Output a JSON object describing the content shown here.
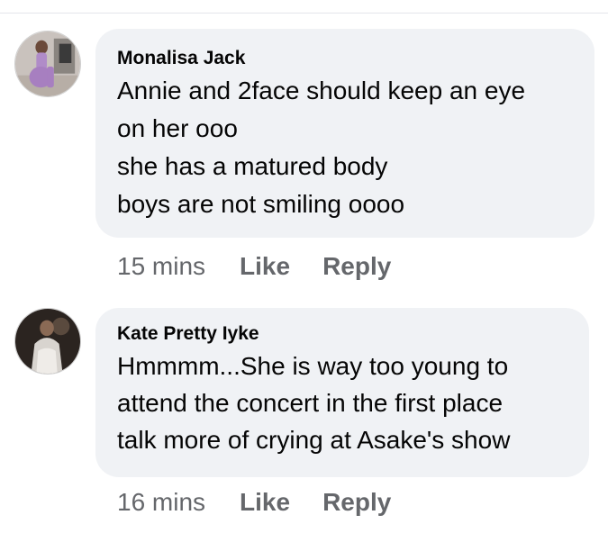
{
  "comments": [
    {
      "author": "Monalisa Jack",
      "lines": [
        "Annie and 2face should keep an eye",
        "on her ooo",
        "she has a matured body",
        "boys are not smiling oooo"
      ],
      "time": "15 mins",
      "like_label": "Like",
      "reply_label": "Reply"
    },
    {
      "author": "Kate Pretty Iyke",
      "lines": [
        "Hmmmm...She is way too young to",
        "attend the concert in the first place",
        "talk more of crying at Asake's show"
      ],
      "time": "16 mins",
      "like_label": "Like",
      "reply_label": "Reply"
    }
  ]
}
